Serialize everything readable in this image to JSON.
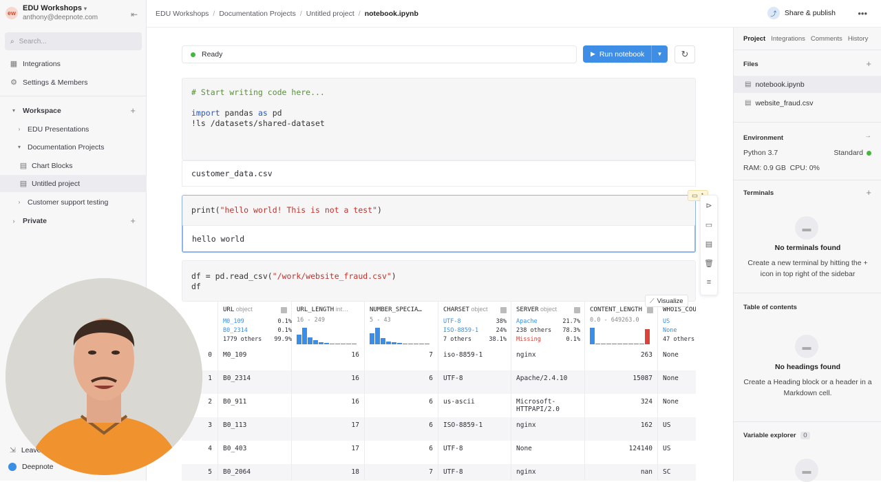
{
  "workspace": {
    "initials": "ew",
    "name": "EDU Workshops",
    "email": "anthony@deepnote.com"
  },
  "search": {
    "placeholder": "Search..."
  },
  "sidebar": {
    "integrations": "Integrations",
    "settings": "Settings & Members",
    "workspace_label": "Workspace",
    "items": [
      "EDU Presentations",
      "Documentation Projects",
      "Chart Blocks",
      "Untitled project",
      "Customer support testing"
    ],
    "private_label": "Private",
    "bottom_partial": "Leave",
    "app_name": "Deepnote"
  },
  "breadcrumb": [
    "EDU Workshops",
    "Documentation Projects",
    "Untitled project",
    "notebook.ipynb"
  ],
  "topbar": {
    "share_label": "Share & publish"
  },
  "notebook": {
    "status": "Ready",
    "run_label": "Run notebook",
    "cell1": {
      "comment": "# Start writing code here...",
      "kw1": "import",
      "l2a": " pandas ",
      "kw2": "as",
      "l2b": " pd",
      "line3": "!ls /datasets/shared-dataset",
      "output": "customer_data.csv"
    },
    "cell2": {
      "fn": "print(",
      "str": "\"hello world! This is not a test\"",
      "end": ")",
      "output": "hello world",
      "comment_count": "1"
    },
    "cell3": {
      "l1a": "df = pd.read_csv(",
      "l1s": "\"/work/website_fraud.csv\"",
      "l1b": ")",
      "l2": "df"
    },
    "visualize_label": "Visualize"
  },
  "table": {
    "columns": [
      {
        "name": "URL",
        "type": "object",
        "stats": [
          [
            "M0_109",
            "0.1%"
          ],
          [
            "B0_2314",
            "0.1%"
          ],
          [
            "1779 others",
            "99.9%"
          ]
        ]
      },
      {
        "name": "URL_LENGTH",
        "type": "int…",
        "range": "16 - 249"
      },
      {
        "name": "NUMBER_SPECIA…",
        "type": "",
        "range": "5 - 43"
      },
      {
        "name": "CHARSET",
        "type": "object",
        "stats": [
          [
            "UTF-8",
            "38%"
          ],
          [
            "ISO-8859-1",
            "24%"
          ],
          [
            "7 others",
            "38.1%"
          ]
        ]
      },
      {
        "name": "SERVER",
        "type": "object",
        "stats": [
          [
            "Apache",
            "21.7%"
          ],
          [
            "238 others",
            "78.3%"
          ],
          [
            "Missing",
            "0.1%"
          ]
        ]
      },
      {
        "name": "CONTENT_LENGTH",
        "type": "",
        "range": "0.0 - 649263.0"
      },
      {
        "name": "WHOIS_COU",
        "type": "",
        "stats": [
          [
            "US",
            ""
          ],
          [
            "None",
            ""
          ],
          [
            "47 others",
            ""
          ]
        ]
      }
    ],
    "rows": [
      [
        "0",
        "M0_109",
        "16",
        "7",
        "iso-8859-1",
        "nginx",
        "263",
        "None"
      ],
      [
        "1",
        "B0_2314",
        "16",
        "6",
        "UTF-8",
        "Apache/2.4.10",
        "15087",
        "None"
      ],
      [
        "2",
        "B0_911",
        "16",
        "6",
        "us-ascii",
        "Microsoft-HTTPAPI/2.0",
        "324",
        "None"
      ],
      [
        "3",
        "B0_113",
        "17",
        "6",
        "ISO-8859-1",
        "nginx",
        "162",
        "US"
      ],
      [
        "4",
        "B0_403",
        "17",
        "6",
        "UTF-8",
        "None",
        "124140",
        "US"
      ],
      [
        "5",
        "B0_2064",
        "18",
        "7",
        "UTF-8",
        "nginx",
        "nan",
        "SC"
      ]
    ]
  },
  "right": {
    "tabs": [
      "Project",
      "Integrations",
      "Comments",
      "History"
    ],
    "files_label": "Files",
    "files": [
      "notebook.ipynb",
      "website_fraud.csv"
    ],
    "env_label": "Environment",
    "python": "Python 3.7",
    "machine": "Standard",
    "resources": "RAM: 0.9 GB  CPU: 0%",
    "terminals_label": "Terminals",
    "no_terminals": "No terminals found",
    "no_terminals_text": "Create a new terminal by hitting the + icon in top right of the sidebar",
    "toc_label": "Table of contents",
    "no_headings": "No headings found",
    "no_headings_text": "Create a Heading block or a header in a Markdown cell.",
    "varexp_label": "Variable explorer",
    "var_count": "0"
  }
}
